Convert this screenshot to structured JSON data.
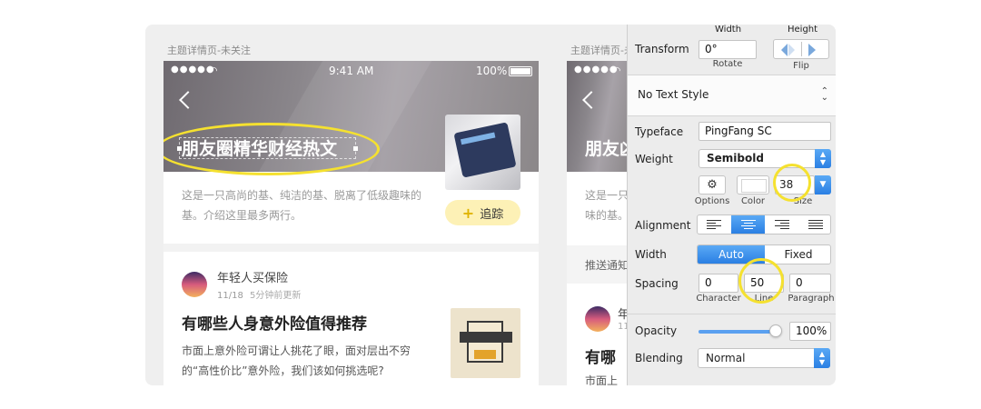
{
  "artboards": {
    "first_label": "主题详情页-未关注",
    "second_label": "主题详情页-未关注"
  },
  "status_bar": {
    "dots": "●●●●●",
    "time": "9:41 AM",
    "battery": "100%"
  },
  "topic": {
    "title": "朋友圈精华财经热文",
    "description": "这是一只高尚的基、纯洁的基、脱离了低级趣味的基。介绍这里最多两行。",
    "follow_label": "追踪",
    "follow_plus": "+"
  },
  "post": {
    "author": "年轻人买保险",
    "date": "11/18",
    "updated": "5分钟前更新",
    "title": "有哪些人身意外险值得推荐",
    "excerpt": "市面上意外险可谓让人挑花了眼，面对层出不穷的“高性价比”意外险，我们该如何挑选呢?"
  },
  "second_phone": {
    "title": "朋友凶",
    "desc_line1": "这是一只",
    "desc_line2": "味的基。",
    "band_text": "推送通知",
    "author_partial": "年",
    "meta_partial": "11",
    "article_partial": "有哪",
    "excerpt_partial": "市面上"
  },
  "inspector": {
    "width_label": "Width",
    "height_label": "Height",
    "transform_label": "Transform",
    "rotate_value": "0°",
    "rotate_label": "Rotate",
    "flip_label": "Flip",
    "text_style": "No Text Style",
    "typeface_label": "Typeface",
    "typeface_value": "PingFang SC",
    "weight_label": "Weight",
    "weight_value": "Semibold",
    "options_label": "Options",
    "color_label": "Color",
    "size_label": "Size",
    "size_value": "38",
    "alignment_label": "Alignment",
    "width_mode_label": "Width",
    "width_auto": "Auto",
    "width_fixed": "Fixed",
    "spacing_label": "Spacing",
    "character_value": "0",
    "line_value": "50",
    "paragraph_value": "0",
    "character_label": "Character",
    "line_label": "Line",
    "paragraph_label": "Paragraph",
    "opacity_label": "Opacity",
    "opacity_value": "100%",
    "opacity_level": 1.0,
    "blending_label": "Blending",
    "blending_value": "Normal"
  },
  "colors": {
    "highlight_ring": "#f5e12f",
    "accent_blue": "#2a7fe3",
    "follow_bg": "#fdf1b6"
  }
}
